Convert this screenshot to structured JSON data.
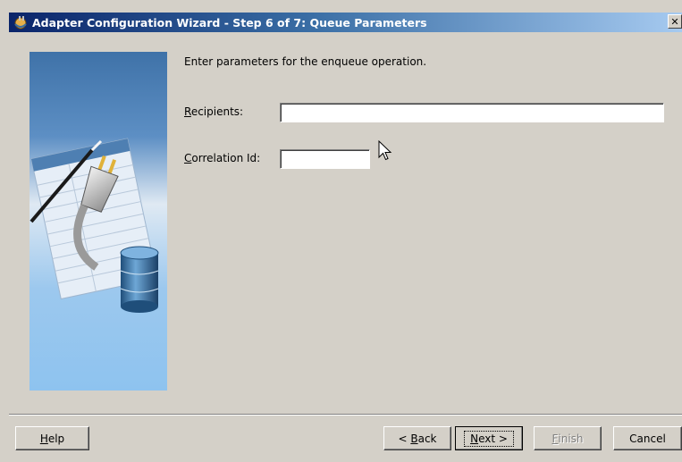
{
  "window": {
    "title": "Adapter Configuration Wizard - Step 6 of 7: Queue Parameters",
    "close_glyph": "✕"
  },
  "main": {
    "instruction": "Enter parameters for the enqueue operation.",
    "fields": [
      {
        "label_mnemonic": "R",
        "label_rest": "ecipients:",
        "value": ""
      },
      {
        "label_mnemonic": "C",
        "label_rest": "orrelation Id:",
        "value": ""
      }
    ]
  },
  "buttons": {
    "help": {
      "mnemonic": "H",
      "rest": "elp"
    },
    "back": {
      "prefix": "< ",
      "mnemonic": "B",
      "rest": "ack"
    },
    "next": {
      "mnemonic": "N",
      "rest": "ext >"
    },
    "finish": {
      "mnemonic": "F",
      "rest": "inish",
      "enabled": false
    },
    "cancel": {
      "label": "Cancel"
    }
  },
  "colors": {
    "window_bg": "#d4d0c8",
    "titlebar_start": "#0a246a",
    "titlebar_end": "#a6caf0",
    "panel_blue": "#8ec3ef"
  },
  "icons": {
    "app": "adapter-wizard-icon",
    "side_graphic": "plug-and-database-illustration",
    "pointer": "mouse-cursor-icon"
  }
}
